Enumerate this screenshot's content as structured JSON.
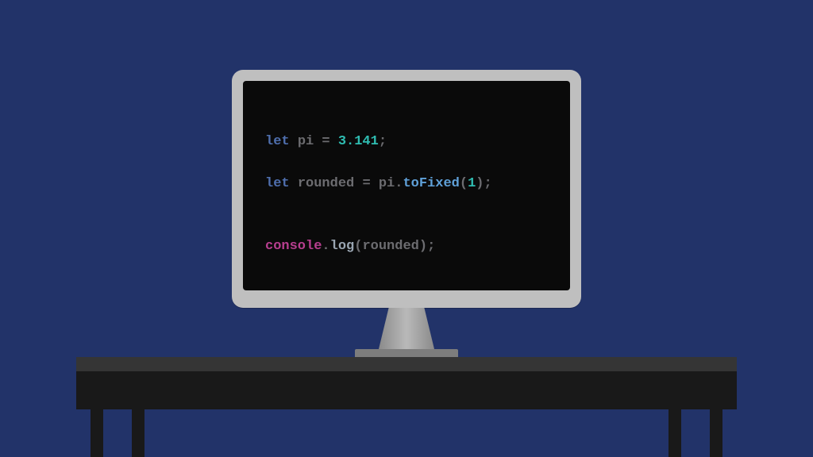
{
  "colors": {
    "background": "#223369",
    "monitor_bezel": "#bfbfbf",
    "screen": "#0a0a0a",
    "desk_top": "#353535",
    "desk_front": "#191919",
    "stand": "#8a8a8a",
    "syntax": {
      "keyword": "#4f6fae",
      "identifier": "#6c6c70",
      "operator": "#6c6c70",
      "number": "#2fbcb1",
      "method_blue": "#5fa0d8",
      "console": "#b73e8f",
      "log": "#9aa6b2"
    }
  },
  "code": {
    "line1": {
      "kw": "let",
      "sp1": " ",
      "var": "pi",
      "sp2": " ",
      "eq": "=",
      "sp3": " ",
      "num": "3.141",
      "semi": ";"
    },
    "line2": {
      "kw": "let",
      "sp1": " ",
      "var": "rounded",
      "sp2": " ",
      "eq": "=",
      "sp3": " ",
      "obj": "pi",
      "dot": ".",
      "method": "toFixed",
      "lp": "(",
      "arg": "1",
      "rp": ")",
      "semi": ";"
    },
    "line3": {
      "obj": "console",
      "dot": ".",
      "method": "log",
      "lp": "(",
      "arg": "rounded",
      "rp": ")",
      "semi": ";"
    }
  }
}
